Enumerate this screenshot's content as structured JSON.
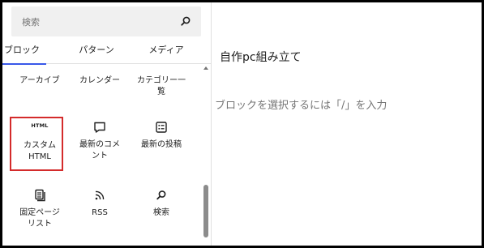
{
  "search": {
    "placeholder": "検索"
  },
  "tabs": [
    {
      "label": "ブロック",
      "active": true
    },
    {
      "label": "パターン",
      "active": false
    },
    {
      "label": "メディア",
      "active": false
    }
  ],
  "blocks": [
    {
      "label": "アーカイブ",
      "icon": "archive-icon"
    },
    {
      "label": "カレンダー",
      "icon": "calendar-icon"
    },
    {
      "label": "カテゴリー一覧",
      "icon": "categories-icon"
    },
    {
      "label": "カスタムHTML",
      "icon": "html-icon",
      "icon_text": "HTML",
      "highlighted": true
    },
    {
      "label": "最新のコメント",
      "icon": "comment-icon"
    },
    {
      "label": "最新の投稿",
      "icon": "post-list-icon"
    },
    {
      "label": "固定ページリスト",
      "icon": "pages-icon"
    },
    {
      "label": "RSS",
      "icon": "rss-icon"
    },
    {
      "label": "検索",
      "icon": "search-icon"
    }
  ],
  "editor": {
    "title": "自作pc組み立て",
    "placeholder": "ブロックを選択するには「/」を入力"
  },
  "colors": {
    "tab_active": "#3858e9",
    "highlight": "#d42b2b"
  }
}
